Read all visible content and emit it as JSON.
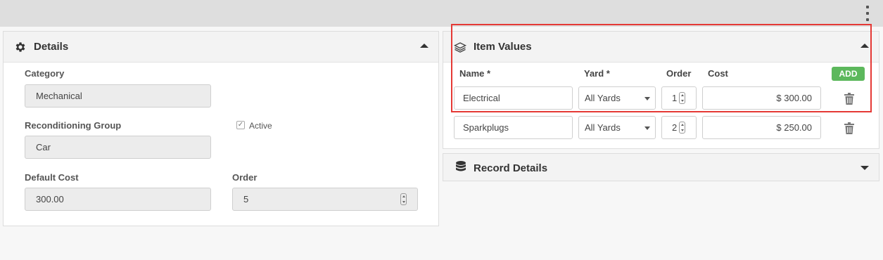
{
  "icons": {
    "menu": "vertical-ellipsis-icon",
    "details": "gear-icon",
    "item_values": "layers-icon",
    "record_details": "database-icon",
    "delete": "trash-icon"
  },
  "colors": {
    "add_button": "#5cb85c",
    "highlight_border": "#e53935"
  },
  "details": {
    "title": "Details",
    "category_label": "Category",
    "category_value": "Mechanical",
    "recon_group_label": "Reconditioning Group",
    "recon_group_value": "Car",
    "active_label": "Active",
    "active_checked": true,
    "default_cost_label": "Default Cost",
    "default_cost_value": "300.00",
    "order_label": "Order",
    "order_value": "5"
  },
  "item_values": {
    "title": "Item Values",
    "columns": {
      "name": "Name *",
      "yard": "Yard *",
      "order": "Order",
      "cost": "Cost"
    },
    "add_label": "ADD",
    "rows": [
      {
        "name": "Electrical",
        "yard": "All Yards",
        "order": "1",
        "cost": "$ 300.00"
      },
      {
        "name": "Sparkplugs",
        "yard": "All Yards",
        "order": "2",
        "cost": "$ 250.00"
      }
    ]
  },
  "record_details": {
    "title": "Record Details"
  }
}
